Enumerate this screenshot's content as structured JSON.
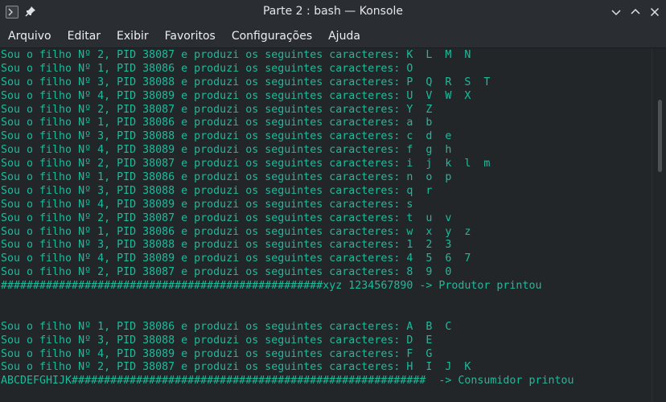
{
  "window": {
    "title": "Parte 2 : bash — Konsole",
    "app_icon": "terminal-icon",
    "pin_icon": "pin-icon",
    "controls": [
      "chevron-down-icon",
      "chevron-up-icon",
      "close-icon"
    ]
  },
  "menu": [
    "Arquivo",
    "Editar",
    "Exibir",
    "Favoritos",
    "Configurações",
    "Ajuda"
  ],
  "terminal": {
    "text_color": "#1abc9c",
    "background": "#232629",
    "lines": [
      "Sou o filho Nº 2, PID 38087 e produzi os seguintes caracteres: K  L  M  N",
      "Sou o filho Nº 1, PID 38086 e produzi os seguintes caracteres: O",
      "Sou o filho Nº 3, PID 38088 e produzi os seguintes caracteres: P  Q  R  S  T",
      "Sou o filho Nº 4, PID 38089 e produzi os seguintes caracteres: U  V  W  X",
      "Sou o filho Nº 2, PID 38087 e produzi os seguintes caracteres: Y  Z",
      "Sou o filho Nº 1, PID 38086 e produzi os seguintes caracteres: a  b",
      "Sou o filho Nº 3, PID 38088 e produzi os seguintes caracteres: c  d  e",
      "Sou o filho Nº 4, PID 38089 e produzi os seguintes caracteres: f  g  h",
      "Sou o filho Nº 2, PID 38087 e produzi os seguintes caracteres: i  j  k  l  m",
      "Sou o filho Nº 1, PID 38086 e produzi os seguintes caracteres: n  o  p",
      "Sou o filho Nº 3, PID 38088 e produzi os seguintes caracteres: q  r",
      "Sou o filho Nº 4, PID 38089 e produzi os seguintes caracteres: s",
      "Sou o filho Nº 2, PID 38087 e produzi os seguintes caracteres: t  u  v",
      "Sou o filho Nº 1, PID 38086 e produzi os seguintes caracteres: w  x  y  z",
      "Sou o filho Nº 3, PID 38088 e produzi os seguintes caracteres: 1  2  3",
      "Sou o filho Nº 4, PID 38089 e produzi os seguintes caracteres: 4  5  6  7",
      "Sou o filho Nº 2, PID 38087 e produzi os seguintes caracteres: 8  9  0",
      "##################################################xyz 1234567890 -> Produtor printou",
      "",
      "",
      "Sou o filho Nº 1, PID 38086 e produzi os seguintes caracteres: A  B  C",
      "Sou o filho Nº 3, PID 38088 e produzi os seguintes caracteres: D  E",
      "Sou o filho Nº 4, PID 38089 e produzi os seguintes caracteres: F  G",
      "Sou o filho Nº 2, PID 38087 e produzi os seguintes caracteres: H  I  J  K",
      "ABCDEFGHIJK#######################################################  -> Consumidor printou"
    ]
  }
}
